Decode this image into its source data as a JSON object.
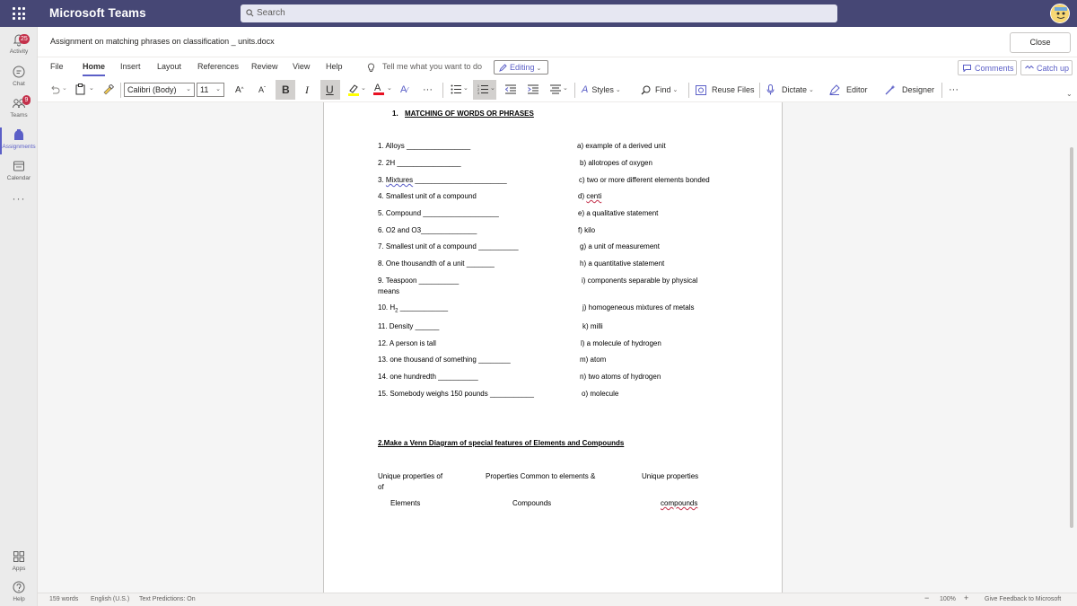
{
  "app": {
    "title": "Microsoft Teams"
  },
  "search": {
    "placeholder": "Search"
  },
  "rail": [
    {
      "label": "Activity",
      "badge": "25"
    },
    {
      "label": "Chat"
    },
    {
      "label": "Teams",
      "badge": "9"
    },
    {
      "label": "Assignments"
    },
    {
      "label": "Calendar"
    },
    {
      "label": "Apps"
    },
    {
      "label": "Help"
    }
  ],
  "doc": {
    "title": "Assignment on matching phrases on classification _ units.docx",
    "close_label": "Close"
  },
  "menu": {
    "items": [
      "File",
      "Home",
      "Insert",
      "Layout",
      "References",
      "Review",
      "View",
      "Help"
    ],
    "tell_me": "Tell me what you want to do",
    "editing": "Editing",
    "comments": "Comments",
    "catch_up": "Catch up"
  },
  "ribbon": {
    "font_name": "Calibri (Body)",
    "font_size": "11",
    "styles": "Styles",
    "find": "Find",
    "reuse_files": "Reuse Files",
    "dictate": "Dictate",
    "editor": "Editor",
    "designer": "Designer"
  },
  "document": {
    "heading1_num": "1.",
    "heading1": "MATCHING OF WORDS OR PHRASES",
    "left": [
      "1. Alloys ________________",
      "2. 2H ________________",
      "3. Mixtures _______________________",
      "4. Smallest unit of a compound",
      "5. Compound ___________________",
      "6. O2 and O3______________",
      "7. Smallest unit of a compound __________",
      "8. One thousandth of a unit _______",
      "9. Teaspoon __________",
      "means",
      "10. H",
      "11. Density ______",
      "12. A person is tall",
      "13. one thousand of something ________",
      "14. one hundredth __________",
      "15. Somebody weighs 150 pounds ___________"
    ],
    "h2_sub": "2",
    "h2_line": "____________",
    "right": [
      "a) example of a derived unit",
      "b) allotropes of oxygen",
      "c) two or more different elements bonded",
      "d) centi",
      "e) a qualitative statement",
      "f) kilo",
      "g) a unit of measurement",
      "h) a quantitative statement",
      "i) components separable by physical",
      "j) homogeneous mixtures of metals",
      "k) milli",
      "l) a molecule of hydrogen",
      "m) atom",
      "n) two atoms of hydrogen",
      "o) molecule"
    ],
    "heading2": "2.Make a Venn Diagram of special features of Elements and Compounds",
    "venn_col1": "Unique properties of",
    "venn_col1b": "of",
    "venn_col2": "Properties Common to elements &",
    "venn_col3": "Unique properties",
    "venn_row2_1": "Elements",
    "venn_row2_2": "Compounds",
    "venn_row2_3": "compounds"
  },
  "status": {
    "words": "159 words",
    "language": "English (U.S.)",
    "predictions": "Text Predictions: On",
    "zoom": "100%",
    "feedback": "Give Feedback to Microsoft"
  }
}
